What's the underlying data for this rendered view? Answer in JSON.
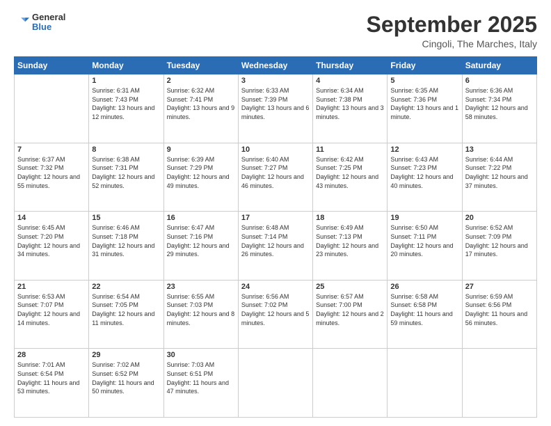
{
  "header": {
    "logo": {
      "general": "General",
      "blue": "Blue"
    },
    "title": "September 2025",
    "subtitle": "Cingoli, The Marches, Italy"
  },
  "weekdays": [
    "Sunday",
    "Monday",
    "Tuesday",
    "Wednesday",
    "Thursday",
    "Friday",
    "Saturday"
  ],
  "weeks": [
    [
      {
        "day": null,
        "data": null
      },
      {
        "day": "1",
        "data": {
          "sunrise": "Sunrise: 6:31 AM",
          "sunset": "Sunset: 7:43 PM",
          "daylight": "Daylight: 13 hours and 12 minutes."
        }
      },
      {
        "day": "2",
        "data": {
          "sunrise": "Sunrise: 6:32 AM",
          "sunset": "Sunset: 7:41 PM",
          "daylight": "Daylight: 13 hours and 9 minutes."
        }
      },
      {
        "day": "3",
        "data": {
          "sunrise": "Sunrise: 6:33 AM",
          "sunset": "Sunset: 7:39 PM",
          "daylight": "Daylight: 13 hours and 6 minutes."
        }
      },
      {
        "day": "4",
        "data": {
          "sunrise": "Sunrise: 6:34 AM",
          "sunset": "Sunset: 7:38 PM",
          "daylight": "Daylight: 13 hours and 3 minutes."
        }
      },
      {
        "day": "5",
        "data": {
          "sunrise": "Sunrise: 6:35 AM",
          "sunset": "Sunset: 7:36 PM",
          "daylight": "Daylight: 13 hours and 1 minute."
        }
      },
      {
        "day": "6",
        "data": {
          "sunrise": "Sunrise: 6:36 AM",
          "sunset": "Sunset: 7:34 PM",
          "daylight": "Daylight: 12 hours and 58 minutes."
        }
      }
    ],
    [
      {
        "day": "7",
        "data": {
          "sunrise": "Sunrise: 6:37 AM",
          "sunset": "Sunset: 7:32 PM",
          "daylight": "Daylight: 12 hours and 55 minutes."
        }
      },
      {
        "day": "8",
        "data": {
          "sunrise": "Sunrise: 6:38 AM",
          "sunset": "Sunset: 7:31 PM",
          "daylight": "Daylight: 12 hours and 52 minutes."
        }
      },
      {
        "day": "9",
        "data": {
          "sunrise": "Sunrise: 6:39 AM",
          "sunset": "Sunset: 7:29 PM",
          "daylight": "Daylight: 12 hours and 49 minutes."
        }
      },
      {
        "day": "10",
        "data": {
          "sunrise": "Sunrise: 6:40 AM",
          "sunset": "Sunset: 7:27 PM",
          "daylight": "Daylight: 12 hours and 46 minutes."
        }
      },
      {
        "day": "11",
        "data": {
          "sunrise": "Sunrise: 6:42 AM",
          "sunset": "Sunset: 7:25 PM",
          "daylight": "Daylight: 12 hours and 43 minutes."
        }
      },
      {
        "day": "12",
        "data": {
          "sunrise": "Sunrise: 6:43 AM",
          "sunset": "Sunset: 7:23 PM",
          "daylight": "Daylight: 12 hours and 40 minutes."
        }
      },
      {
        "day": "13",
        "data": {
          "sunrise": "Sunrise: 6:44 AM",
          "sunset": "Sunset: 7:22 PM",
          "daylight": "Daylight: 12 hours and 37 minutes."
        }
      }
    ],
    [
      {
        "day": "14",
        "data": {
          "sunrise": "Sunrise: 6:45 AM",
          "sunset": "Sunset: 7:20 PM",
          "daylight": "Daylight: 12 hours and 34 minutes."
        }
      },
      {
        "day": "15",
        "data": {
          "sunrise": "Sunrise: 6:46 AM",
          "sunset": "Sunset: 7:18 PM",
          "daylight": "Daylight: 12 hours and 31 minutes."
        }
      },
      {
        "day": "16",
        "data": {
          "sunrise": "Sunrise: 6:47 AM",
          "sunset": "Sunset: 7:16 PM",
          "daylight": "Daylight: 12 hours and 29 minutes."
        }
      },
      {
        "day": "17",
        "data": {
          "sunrise": "Sunrise: 6:48 AM",
          "sunset": "Sunset: 7:14 PM",
          "daylight": "Daylight: 12 hours and 26 minutes."
        }
      },
      {
        "day": "18",
        "data": {
          "sunrise": "Sunrise: 6:49 AM",
          "sunset": "Sunset: 7:13 PM",
          "daylight": "Daylight: 12 hours and 23 minutes."
        }
      },
      {
        "day": "19",
        "data": {
          "sunrise": "Sunrise: 6:50 AM",
          "sunset": "Sunset: 7:11 PM",
          "daylight": "Daylight: 12 hours and 20 minutes."
        }
      },
      {
        "day": "20",
        "data": {
          "sunrise": "Sunrise: 6:52 AM",
          "sunset": "Sunset: 7:09 PM",
          "daylight": "Daylight: 12 hours and 17 minutes."
        }
      }
    ],
    [
      {
        "day": "21",
        "data": {
          "sunrise": "Sunrise: 6:53 AM",
          "sunset": "Sunset: 7:07 PM",
          "daylight": "Daylight: 12 hours and 14 minutes."
        }
      },
      {
        "day": "22",
        "data": {
          "sunrise": "Sunrise: 6:54 AM",
          "sunset": "Sunset: 7:05 PM",
          "daylight": "Daylight: 12 hours and 11 minutes."
        }
      },
      {
        "day": "23",
        "data": {
          "sunrise": "Sunrise: 6:55 AM",
          "sunset": "Sunset: 7:03 PM",
          "daylight": "Daylight: 12 hours and 8 minutes."
        }
      },
      {
        "day": "24",
        "data": {
          "sunrise": "Sunrise: 6:56 AM",
          "sunset": "Sunset: 7:02 PM",
          "daylight": "Daylight: 12 hours and 5 minutes."
        }
      },
      {
        "day": "25",
        "data": {
          "sunrise": "Sunrise: 6:57 AM",
          "sunset": "Sunset: 7:00 PM",
          "daylight": "Daylight: 12 hours and 2 minutes."
        }
      },
      {
        "day": "26",
        "data": {
          "sunrise": "Sunrise: 6:58 AM",
          "sunset": "Sunset: 6:58 PM",
          "daylight": "Daylight: 11 hours and 59 minutes."
        }
      },
      {
        "day": "27",
        "data": {
          "sunrise": "Sunrise: 6:59 AM",
          "sunset": "Sunset: 6:56 PM",
          "daylight": "Daylight: 11 hours and 56 minutes."
        }
      }
    ],
    [
      {
        "day": "28",
        "data": {
          "sunrise": "Sunrise: 7:01 AM",
          "sunset": "Sunset: 6:54 PM",
          "daylight": "Daylight: 11 hours and 53 minutes."
        }
      },
      {
        "day": "29",
        "data": {
          "sunrise": "Sunrise: 7:02 AM",
          "sunset": "Sunset: 6:52 PM",
          "daylight": "Daylight: 11 hours and 50 minutes."
        }
      },
      {
        "day": "30",
        "data": {
          "sunrise": "Sunrise: 7:03 AM",
          "sunset": "Sunset: 6:51 PM",
          "daylight": "Daylight: 11 hours and 47 minutes."
        }
      },
      {
        "day": null,
        "data": null
      },
      {
        "day": null,
        "data": null
      },
      {
        "day": null,
        "data": null
      },
      {
        "day": null,
        "data": null
      }
    ]
  ]
}
